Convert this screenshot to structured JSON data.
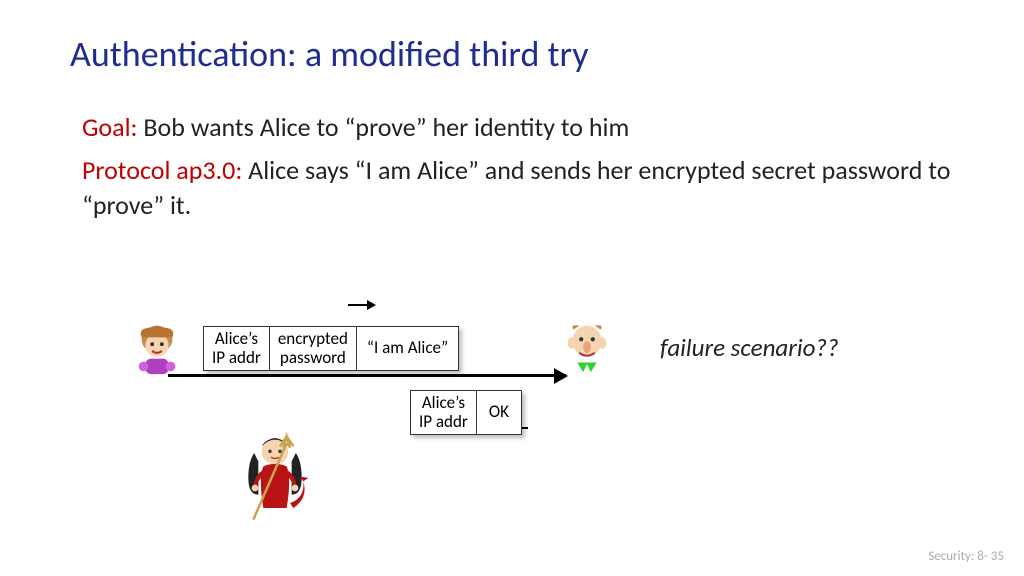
{
  "title": "Authentication: a modified third try",
  "goal_label": "Goal:",
  "goal_text": " Bob wants Alice to “prove” her identity to him",
  "proto_label": "Protocol ap3.0:",
  "proto_text": " Alice says “I am Alice” and sends her encrypted secret password to “prove” it.",
  "packet1": {
    "c1a": "Alice’s",
    "c1b": "IP addr",
    "c2a": "encrypted",
    "c2b": "password",
    "c3": "“I am Alice”"
  },
  "packet2": {
    "c1a": "Alice’s",
    "c1b": "IP addr",
    "c2": "OK"
  },
  "failure": "failure scenario??",
  "footer": "Security: 8- 35",
  "characters": {
    "alice": "alice-icon",
    "bob": "bob-icon",
    "trudy": "trudy-icon"
  }
}
